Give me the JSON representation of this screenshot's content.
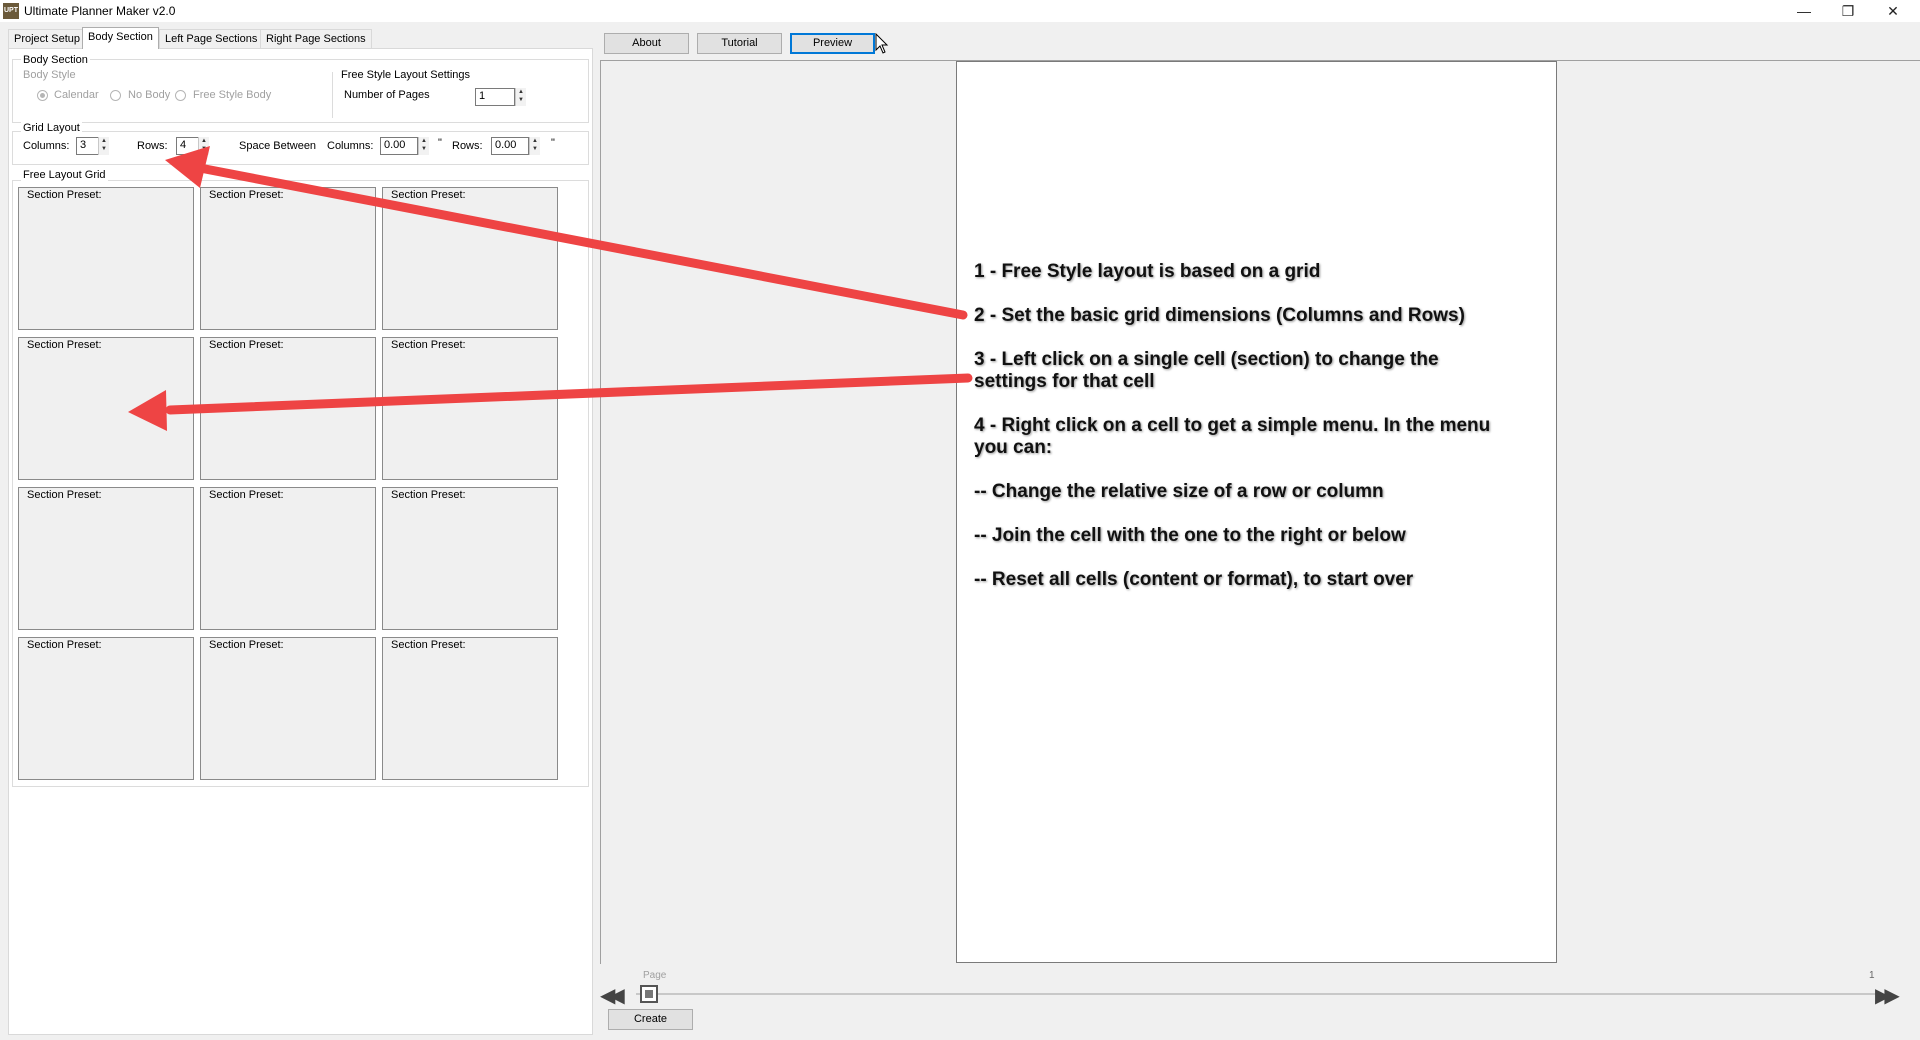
{
  "window": {
    "title": "Ultimate Planner Maker v2.0",
    "icon_text": "UPT",
    "controls": [
      "minimize-icon",
      "restore-icon",
      "close-icon"
    ]
  },
  "tabs": [
    {
      "label": "Project Setup",
      "active": false
    },
    {
      "label": "Body Section",
      "active": true
    },
    {
      "label": "Left Page Sections",
      "active": false
    },
    {
      "label": "Right Page Sections",
      "active": false
    }
  ],
  "body_section": {
    "title": "Body Section",
    "body_style": {
      "title": "Body Style",
      "options": [
        "Calendar",
        "No Body",
        "Free Style Body"
      ],
      "selected": "Calendar"
    },
    "free_style_settings": {
      "title": "Free Style Layout Settings",
      "pages_label": "Number of Pages",
      "pages_value": "1"
    }
  },
  "grid_layout": {
    "title": "Grid Layout",
    "columns_label": "Columns:",
    "columns_value": "3",
    "rows_label": "Rows:",
    "rows_value": "4",
    "space_between_label": "Space Between",
    "space_columns_label": "Columns:",
    "space_columns_value": "0.00",
    "space_rows_label": "Rows:",
    "space_rows_value": "0.00",
    "unit": "\""
  },
  "free_layout_grid": {
    "title": "Free Layout Grid",
    "cell_label": "Section Preset:"
  },
  "toolbar": {
    "about": "About",
    "tutorial": "Tutorial",
    "preview": "Preview"
  },
  "instructions": [
    "1 - Free Style layout is based on a grid",
    "2 - Set the basic grid dimensions (Columns and Rows)",
    "3 - Left click on a single cell (section) to change the settings for that cell",
    "4 - Right click on a cell to get a simple menu. In the menu you can:",
    "-- Change the relative size of a row or column",
    "-- Join the cell with the one to the right or below",
    "-- Reset all cells (content or format), to start over"
  ],
  "page_nav": {
    "label": "Page",
    "current_value": "1",
    "create_label": "Create"
  },
  "colors": {
    "arrow": "#ee4444",
    "accent": "#0078d7",
    "panel_bg": "#f0f0f0"
  }
}
